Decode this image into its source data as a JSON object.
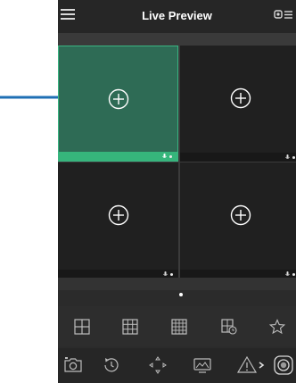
{
  "header": {
    "title": "Live Preview",
    "menu_icon": "hamburger-menu-icon",
    "right_icon": "channel-list-icon"
  },
  "tiles": [
    {
      "state": "selected",
      "add_icon": "add-camera-icon",
      "strip_icons": [
        "mic-icon",
        "dot"
      ]
    },
    {
      "state": "empty",
      "add_icon": "add-camera-icon",
      "strip_icons": [
        "mic-icon",
        "dot"
      ]
    },
    {
      "state": "empty",
      "add_icon": "add-camera-icon",
      "strip_icons": [
        "mic-icon",
        "dot"
      ]
    },
    {
      "state": "empty",
      "add_icon": "add-camera-icon",
      "strip_icons": [
        "mic-icon",
        "dot"
      ]
    }
  ],
  "page_indicator": {
    "current": 1,
    "total": 1
  },
  "layout_toolbar": [
    "layout-2x2-icon",
    "layout-3x3-icon",
    "layout-4x4-icon",
    "layout-schedule-icon",
    "favorite-star-icon"
  ],
  "control_toolbar": [
    "snapshot-camera-icon",
    "playback-icon",
    "ptz-direction-icon",
    "image-settings-icon",
    "alert-icon",
    "more-chevron-icon",
    "record-icon"
  ],
  "colors": {
    "accent_green": "#39b582",
    "selected_tile": "#2e6b55",
    "annotation_arrow": "#1f6fb4",
    "background": "#2b2b2b"
  }
}
